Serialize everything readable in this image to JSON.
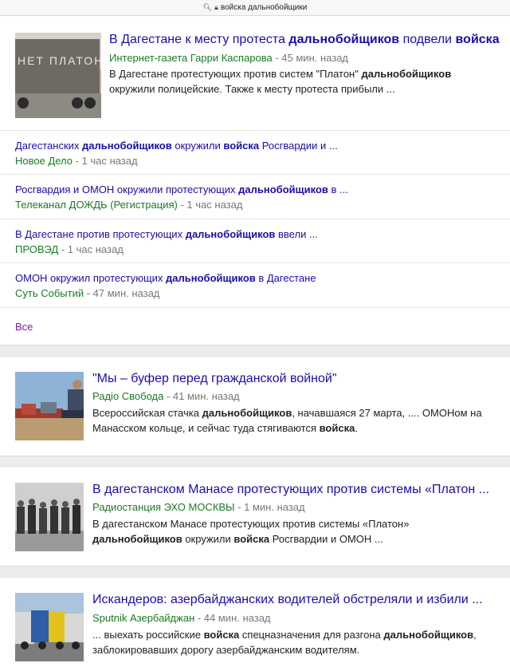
{
  "browser": {
    "url": "войска дальнобойщики"
  },
  "top_story": {
    "title_parts": [
      {
        "t": "В Дагестане к месту протеста ",
        "b": false
      },
      {
        "t": "дальнобойщиков",
        "b": true
      },
      {
        "t": " подвели ",
        "b": false
      },
      {
        "t": "войска",
        "b": true
      }
    ],
    "source": "Интернет-газета Гарри Каспарова",
    "time": " - 45 мин. назад",
    "snippet_parts": [
      {
        "t": "В Дагестане протестующих против систем \"Платон\" ",
        "b": false
      },
      {
        "t": "дальнобойщиков",
        "b": true
      },
      {
        "t": " окружили полицейские. Также к месту протеста прибыли ...",
        "b": false
      }
    ],
    "thumb_text": "НЕТ ПЛАТОН"
  },
  "related": [
    {
      "title_parts": [
        {
          "t": "Дагестанских ",
          "b": false
        },
        {
          "t": "дальнобойщиков",
          "b": true
        },
        {
          "t": " окружили ",
          "b": false
        },
        {
          "t": "войска",
          "b": true
        },
        {
          "t": " Росгвардии и ...",
          "b": false
        }
      ],
      "source": "Новое Дело",
      "time": " - 1 час назад"
    },
    {
      "title_parts": [
        {
          "t": "Росгвардия и ОМОН окружили протестующих ",
          "b": false
        },
        {
          "t": "дальнобойщиков",
          "b": true
        },
        {
          "t": " в ...",
          "b": false
        }
      ],
      "source": "Телеканал ДОЖДЬ (Регистрация)",
      "time": " - 1 час назад"
    },
    {
      "title_parts": [
        {
          "t": "В Дагестане против протестующих ",
          "b": false
        },
        {
          "t": "дальнобойщиков",
          "b": true
        },
        {
          "t": " ввели ...",
          "b": false
        }
      ],
      "source": "ПРОВЭД",
      "time": " - 1 час назад"
    },
    {
      "title_parts": [
        {
          "t": "ОМОН окружил протестующих ",
          "b": false
        },
        {
          "t": "дальнобойщиков",
          "b": true
        },
        {
          "t": " в Дагестане",
          "b": false
        }
      ],
      "source": "Суть Событий",
      "time": " - 47 мин. назад"
    }
  ],
  "all_link": "Все",
  "stories": [
    {
      "title_parts": [
        {
          "t": "\"Мы – буфер перед гражданской войной\"",
          "b": false
        }
      ],
      "source": "Радіо Свобода",
      "time": " - 41 мин. назад",
      "snippet_parts": [
        {
          "t": "Всероссийская стачка ",
          "b": false
        },
        {
          "t": "дальнобойщиков",
          "b": true
        },
        {
          "t": ", начавшаяся 27 марта, .... ОМОНом на Манасском кольце, и сейчас туда стягиваются ",
          "b": false
        },
        {
          "t": "войска",
          "b": true
        },
        {
          "t": ".",
          "b": false
        }
      ]
    },
    {
      "title_parts": [
        {
          "t": "В дагестанском Манасе протестующих против системы «Платон ...",
          "b": false
        }
      ],
      "source": "Радиостанция ЭХО МОСКВЫ",
      "time": " - 1 мин. назад",
      "snippet_parts": [
        {
          "t": "В дагестанском Манасе протестующих против системы «Платон» ",
          "b": false
        },
        {
          "t": "дальнобойщиков",
          "b": true
        },
        {
          "t": " окружили ",
          "b": false
        },
        {
          "t": "войска",
          "b": true
        },
        {
          "t": " Росгвардии и ОМОН ...",
          "b": false
        }
      ]
    },
    {
      "title_parts": [
        {
          "t": "Искандеров: азербайджанских водителей обстреляли и избили ...",
          "b": false
        }
      ],
      "source": "Sputnik Азербайджан",
      "time": " - 44 мин. назад",
      "snippet_parts": [
        {
          "t": "... выехать российские ",
          "b": false
        },
        {
          "t": "войска",
          "b": true
        },
        {
          "t": " спецназначения для разгона ",
          "b": false
        },
        {
          "t": "дальнобойщиков",
          "b": true
        },
        {
          "t": ", заблокировавших дорогу азербайджанским водителям.",
          "b": false
        }
      ]
    }
  ],
  "colors": {
    "link": "#1a0dab",
    "source": "#1a7a23",
    "visited": "#7b1fa2"
  }
}
